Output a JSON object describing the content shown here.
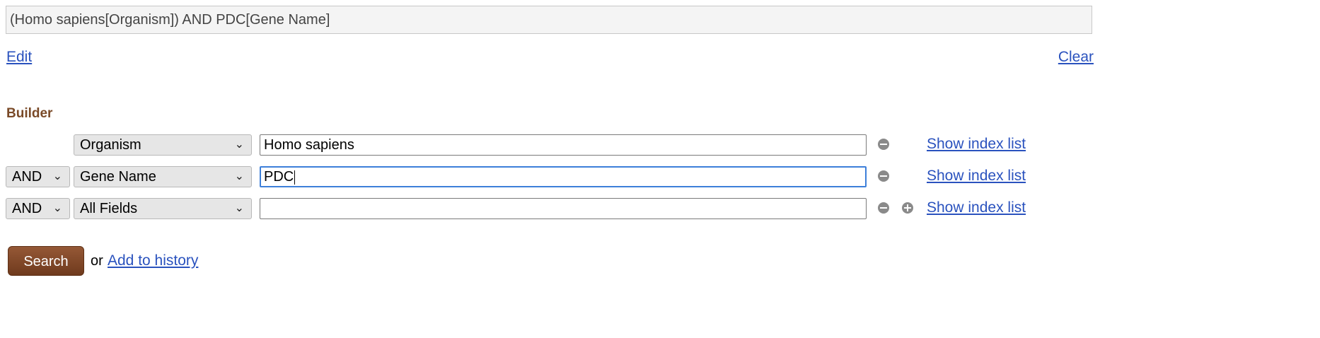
{
  "query": {
    "text": "(Homo sapiens[Organism]) AND PDC[Gene Name]"
  },
  "links": {
    "edit": "Edit",
    "clear": "Clear"
  },
  "builder": {
    "label": "Builder",
    "rows": [
      {
        "operator": "",
        "field": "Organism",
        "term": "Homo sapiens",
        "focused": false,
        "show_add": false,
        "index_link": "Show index list"
      },
      {
        "operator": "AND",
        "field": "Gene Name",
        "term": "PDC",
        "focused": true,
        "show_add": false,
        "index_link": "Show index list"
      },
      {
        "operator": "AND",
        "field": "All Fields",
        "term": "",
        "focused": false,
        "show_add": true,
        "index_link": "Show index list"
      }
    ]
  },
  "actions": {
    "search_label": "Search",
    "or_text": "or",
    "add_to_history": "Add to history"
  },
  "icons": {
    "dropdown": "chevron-down-icon",
    "remove_row": "minus-circle-icon",
    "add_row": "plus-circle-icon"
  },
  "colors": {
    "link": "#2a52be",
    "builder_label": "#7a4a28",
    "search_button": "#7f4526",
    "focus_border": "#3d7fd9"
  }
}
